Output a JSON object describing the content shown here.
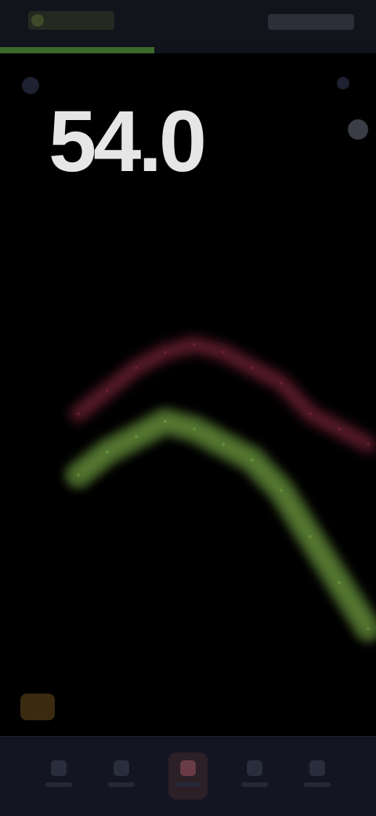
{
  "app": {
    "current_value": "54.0"
  },
  "progress": {
    "fraction": 0.41
  },
  "colors": {
    "accent_green": "#9cdd5c",
    "accent_red": "#c13a5e",
    "progress": "#3a6a2c"
  },
  "icons": {
    "top_left": "menu-icon",
    "top_right": "settings-icon"
  },
  "chart_data": {
    "type": "line",
    "series": [
      {
        "values": [
          44,
          47,
          49,
          51,
          50,
          48,
          46,
          42,
          36,
          30,
          24
        ]
      },
      {
        "values": [
          52,
          55,
          58,
          60,
          61,
          60,
          58,
          56,
          52,
          50,
          48
        ]
      }
    ]
  },
  "nav": {
    "active_index": 2,
    "count": 5
  }
}
